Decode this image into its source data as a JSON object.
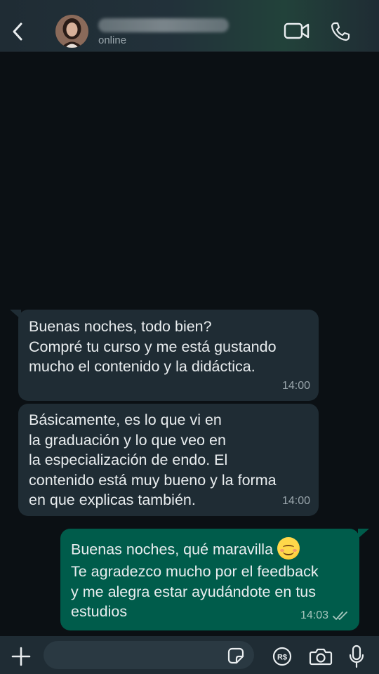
{
  "header": {
    "status": "online",
    "icons": [
      "back-arrow-icon",
      "video-call-icon",
      "phone-icon"
    ]
  },
  "messages": [
    {
      "direction": "incoming",
      "text": "Buenas noches, todo bien?\nCompré tu curso y me está gustando\nmucho el contenido y la didáctica.",
      "time": "14:00"
    },
    {
      "direction": "incoming",
      "text": "Básicamente, es lo que vi en\nla graduación y lo que veo en\nla especialización de endo. El\ncontenido está muy bueno y la forma\nen que explicas también.",
      "time": "14:00"
    },
    {
      "direction": "outgoing",
      "first_line": "Buenas noches, qué maravilla",
      "text": "Te agradezco mucho por el feedback\ny me alegra estar ayudándote en tus\nestudios",
      "emoji": "smiling-face-emoji",
      "time": "14:03",
      "status": "read"
    }
  ],
  "composer": {
    "value": "",
    "placeholder": "",
    "icons": [
      "plus-icon",
      "sticker-icon",
      "payment-icon",
      "camera-icon",
      "microphone-icon"
    ]
  },
  "colors": {
    "background": "#0b1014",
    "header": "#1f2c34",
    "incoming_bubble": "#1f2c34",
    "outgoing_bubble": "#005c4b",
    "read_ticks": "#a8c7bf"
  }
}
